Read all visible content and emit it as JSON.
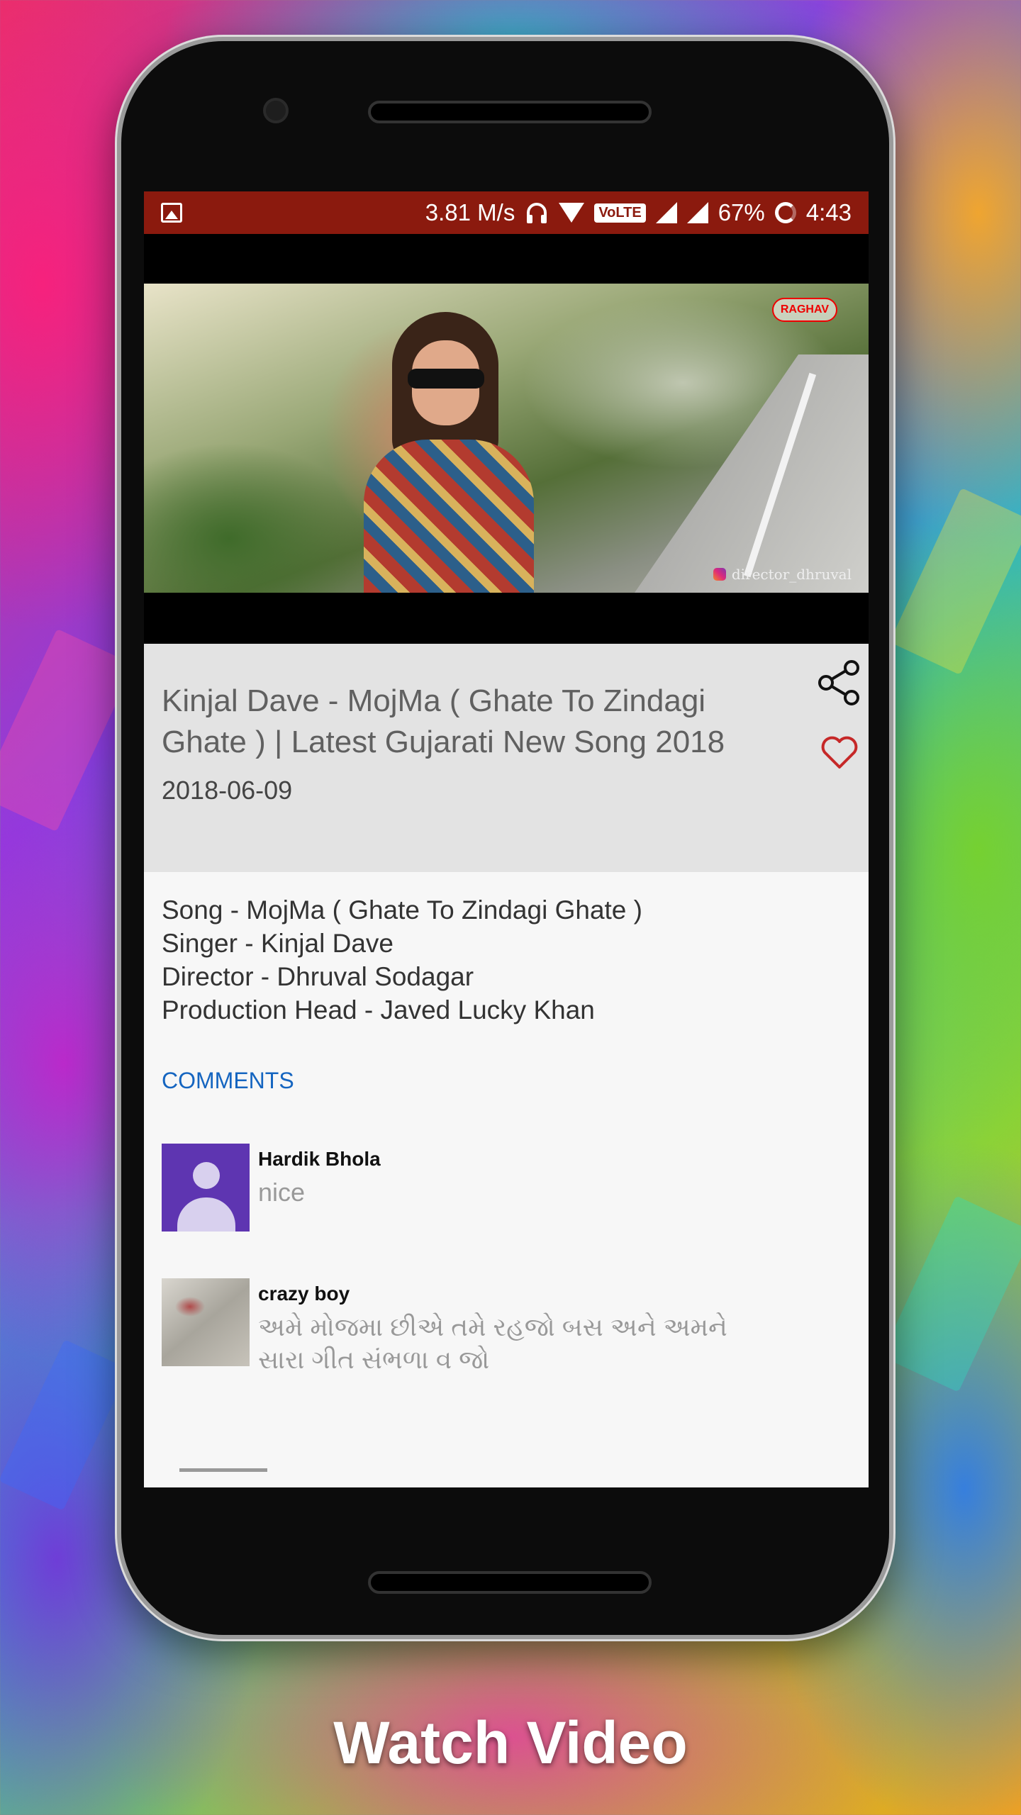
{
  "statusbar": {
    "speed": "3.81 M/s",
    "volte": "VoLTE",
    "battery": "67%",
    "time": "4:43"
  },
  "video": {
    "logo": "RAGHAV",
    "credit": "director_dhruval"
  },
  "info": {
    "title": "Kinjal Dave - MojMa ( Ghate To Zindagi Ghate ) | Latest Gujarati New Song 2018",
    "date": "2018-06-09"
  },
  "details": {
    "lines": [
      "Song - MojMa ( Ghate To Zindagi Ghate )",
      "Singer - Kinjal Dave",
      "Director - Dhruval Sodagar",
      "Production Head - Javed Lucky Khan"
    ],
    "comments_label": "COMMENTS"
  },
  "comments": [
    {
      "author": "Hardik Bhola",
      "text": "nice"
    },
    {
      "author": "crazy boy",
      "text": "અમે મોજમા છીએ તમે રહજો બસ અને અમને સારા ગીત સંભળા વ જો"
    }
  ],
  "caption": "Watch Video",
  "colors": {
    "statusbar": "#8b1a0e",
    "accent_link": "#1565c0",
    "heart": "#c62828"
  }
}
